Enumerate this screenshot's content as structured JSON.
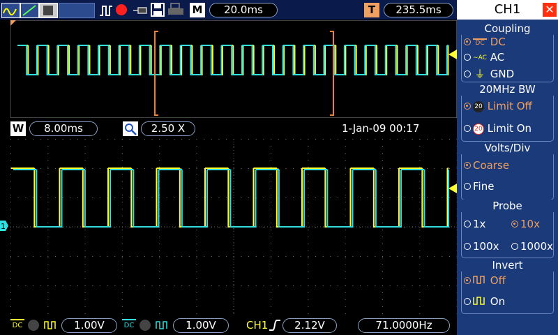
{
  "toolbar": {
    "mode_letter": "M",
    "timebase": "20.0ms",
    "trigger_letter": "T",
    "trigger_delay": "235.5ms"
  },
  "zoom_bar": {
    "window_letter": "W",
    "window_timebase": "8.00ms",
    "zoom_factor": "2.50 X",
    "datetime": "1-Jan-09 00:17"
  },
  "status_bar": {
    "ch1_coupling_label": "DC",
    "ch1_volts": "1.00V",
    "ch2_coupling_label": "DC",
    "ch2_volts": "1.00V",
    "trigger_source": "CH1",
    "trigger_level": "2.12V",
    "frequency": "71.0000Hz"
  },
  "menu": {
    "title": "CH1",
    "coupling": {
      "heading": "Coupling",
      "options": [
        {
          "label": "DC",
          "selected": true
        },
        {
          "label": "AC",
          "selected": false
        },
        {
          "label": "GND",
          "selected": false
        }
      ]
    },
    "bw": {
      "heading": "20MHz BW",
      "options": [
        {
          "label": "Limit Off",
          "selected": true
        },
        {
          "label": "Limit On",
          "selected": false
        }
      ]
    },
    "volts": {
      "heading": "Volts/Div",
      "options": [
        {
          "label": "Coarse",
          "selected": true
        },
        {
          "label": "Fine",
          "selected": false
        }
      ]
    },
    "probe": {
      "heading": "Probe",
      "options": [
        {
          "label": "1x",
          "selected": false
        },
        {
          "label": "10x",
          "selected": true
        },
        {
          "label": "100x",
          "selected": false
        },
        {
          "label": "1000x",
          "selected": false
        }
      ]
    },
    "invert": {
      "heading": "Invert",
      "options": [
        {
          "label": "Off",
          "selected": true
        },
        {
          "label": "On",
          "selected": false
        }
      ]
    }
  },
  "colors": {
    "ch1": "#ffff30",
    "ch2": "#30e0e0",
    "accent": "#f0a060",
    "panel": "#1a3a7a"
  },
  "waveform": {
    "ch1_label": "1",
    "frequency_hz": 71.0
  }
}
